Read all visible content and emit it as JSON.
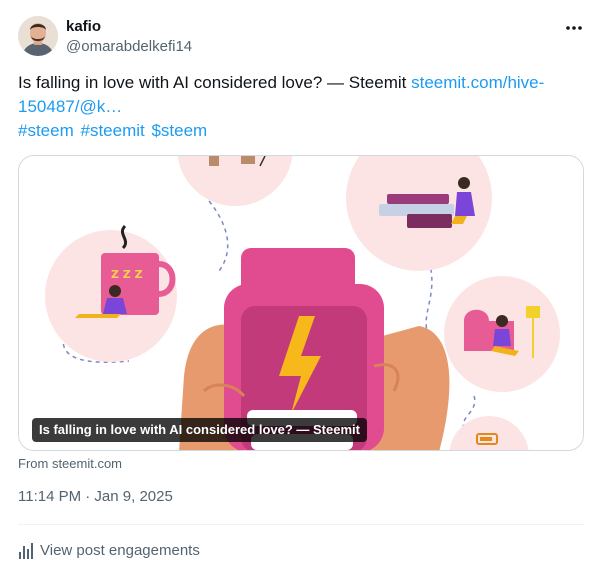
{
  "author": {
    "display_name": "kafio",
    "handle": "@omarabdelkefi14"
  },
  "tweet": {
    "text": "Is falling in love with AI considered love? — Steemit ",
    "link": "steemit.com/hive-150487/@k…",
    "hashtags": [
      "#steem",
      "#steemit",
      "$steem"
    ]
  },
  "card": {
    "title": "Is falling in love with AI considered love? — Steemit",
    "source": "From steemit.com"
  },
  "meta": {
    "timestamp": "11:14 PM · Jan 9, 2025"
  },
  "engagements": {
    "label": "View post engagements",
    "icon": "bar-chart-icon"
  },
  "more": {
    "icon": "more-horizontal-icon"
  },
  "colors": {
    "link": "#1d9bf0",
    "text": "#0f1419",
    "secondary": "#536471",
    "border": "#cfd9de"
  }
}
